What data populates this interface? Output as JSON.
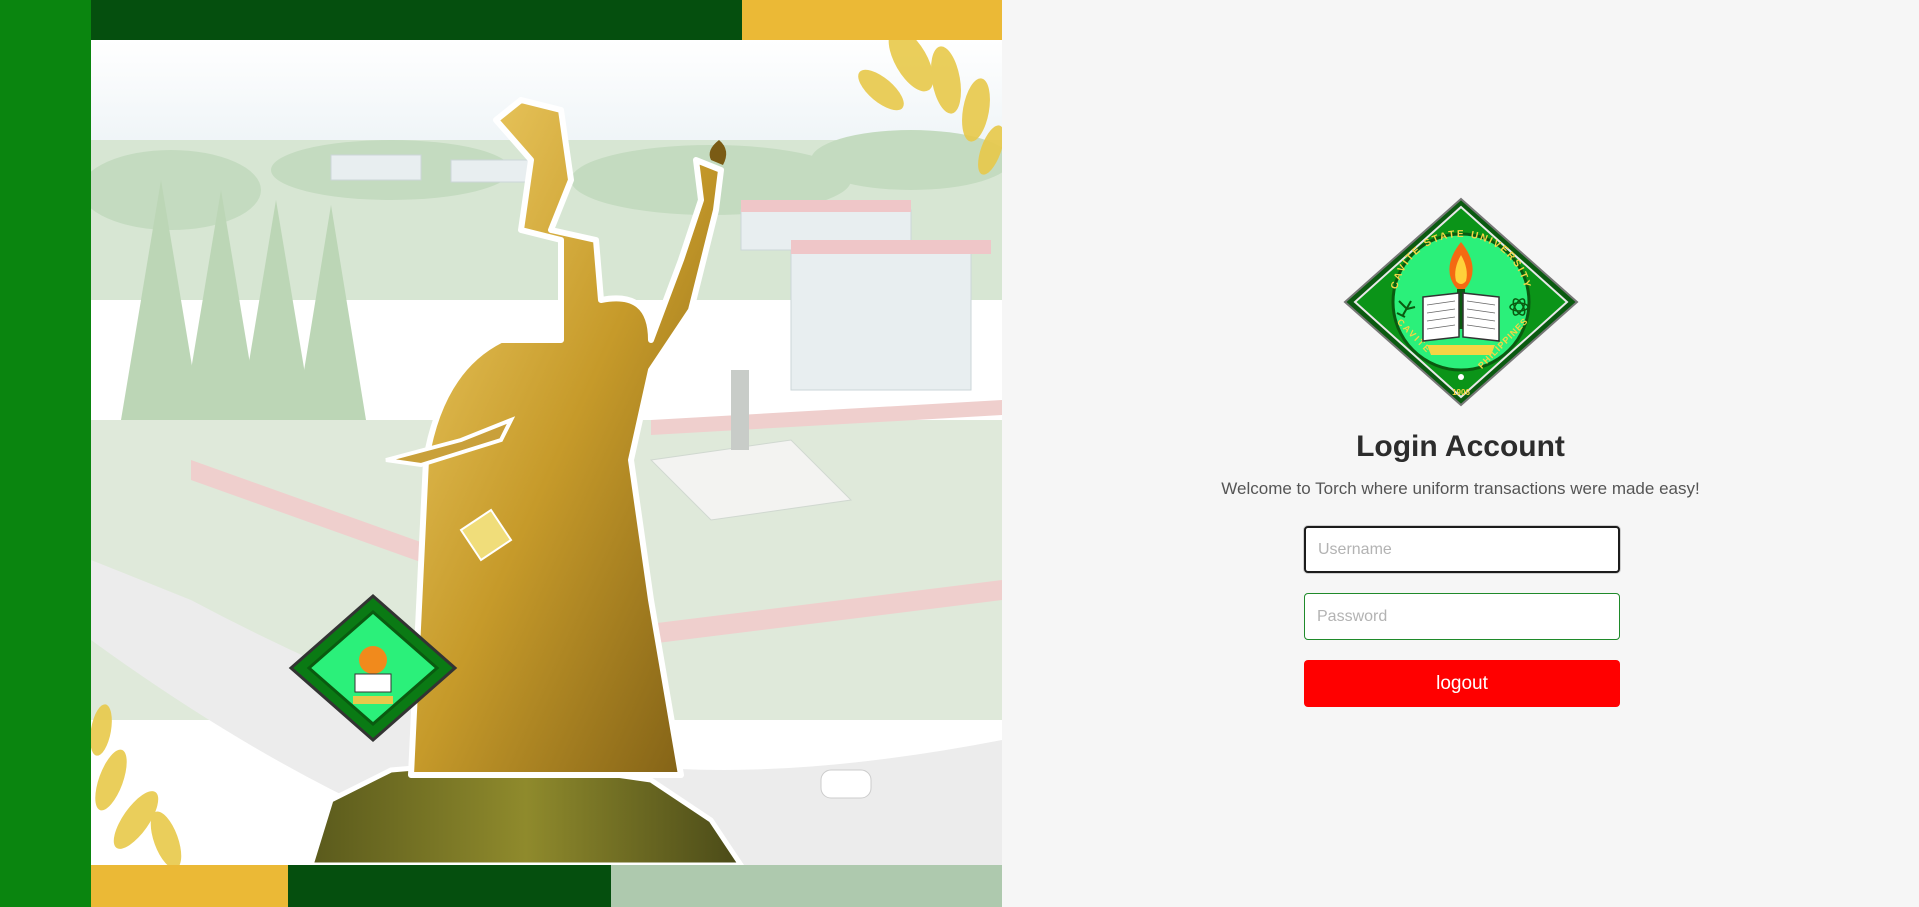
{
  "login": {
    "title": "Login Account",
    "subtitle": "Welcome to Torch where uniform transactions were made easy!",
    "username_placeholder": "Username",
    "password_placeholder": "Password",
    "submit_label": "logout"
  },
  "seal": {
    "arc_top": "CAVITE STATE UNIVERSITY",
    "arc_left": "CAVITE",
    "arc_right": "PHILIPPINES",
    "year": "1906"
  },
  "colors": {
    "sidebar_green": "#0a850f",
    "dark_green": "#054f0e",
    "gold": "#ebb936",
    "light_green": "#aec9ae",
    "button_red": "#ff0000",
    "seal_inner": "#2bf07a"
  },
  "icons": [
    "university-seal-icon",
    "torch-statue-image",
    "campus-photo"
  ]
}
